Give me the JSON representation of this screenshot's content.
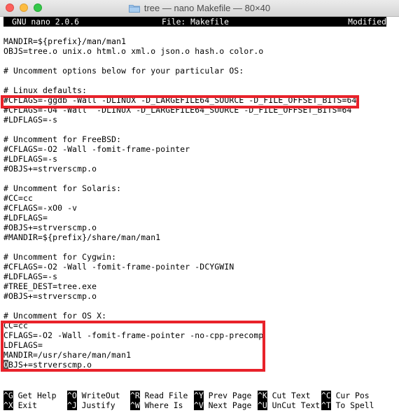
{
  "window": {
    "title": "tree — nano Makefile — 80×40"
  },
  "nano": {
    "version": "GNU nano 2.0.6",
    "file": "File: Makefile",
    "status": "Modified"
  },
  "lines": [
    "MANDIR=${prefix}/man/man1",
    "OBJS=tree.o unix.o html.o xml.o json.o hash.o color.o",
    "",
    "# Uncomment options below for your particular OS:",
    "",
    "# Linux defaults:",
    "#CFLAGS=-ggdb -Wall -DLINUX -D_LARGEFILE64_SOURCE -D_FILE_OFFSET_BITS=64",
    "#CFLAGS=-O4 -Wall  -DLINUX -D_LARGEFILE64_SOURCE -D_FILE_OFFSET_BITS=64",
    "#LDFLAGS=-s",
    "",
    "# Uncomment for FreeBSD:",
    "#CFLAGS=-O2 -Wall -fomit-frame-pointer",
    "#LDFLAGS=-s",
    "#OBJS+=strverscmp.o",
    "",
    "# Uncomment for Solaris:",
    "#CC=cc",
    "#CFLAGS=-xO0 -v",
    "#LDFLAGS=",
    "#OBJS+=strverscmp.o",
    "#MANDIR=${prefix}/share/man/man1",
    "",
    "# Uncomment for Cygwin:",
    "#CFLAGS=-O2 -Wall -fomit-frame-pointer -DCYGWIN",
    "#LDFLAGS=-s",
    "#TREE_DEST=tree.exe",
    "#OBJS+=strverscmp.o",
    "",
    "# Uncomment for OS X:",
    "CC=cc",
    "CFLAGS=-O2 -Wall -fomit-frame-pointer -no-cpp-precomp",
    "LDFLAGS=",
    "MANDIR=/usr/share/man/man1",
    "BJS+=strverscmp.o"
  ],
  "cursor_char": "O",
  "shortcuts": [
    {
      "key": "^G",
      "label": "Get Help"
    },
    {
      "key": "^O",
      "label": "WriteOut"
    },
    {
      "key": "^R",
      "label": "Read File"
    },
    {
      "key": "^Y",
      "label": "Prev Page"
    },
    {
      "key": "^K",
      "label": "Cut Text"
    },
    {
      "key": "^C",
      "label": "Cur Pos"
    },
    {
      "key": "^X",
      "label": "Exit"
    },
    {
      "key": "^J",
      "label": "Justify"
    },
    {
      "key": "^W",
      "label": "Where Is"
    },
    {
      "key": "^V",
      "label": "Next Page"
    },
    {
      "key": "^U",
      "label": "UnCut Text"
    },
    {
      "key": "^T",
      "label": "To Spell"
    }
  ],
  "colors": {
    "highlight_border": "#e8222a"
  }
}
